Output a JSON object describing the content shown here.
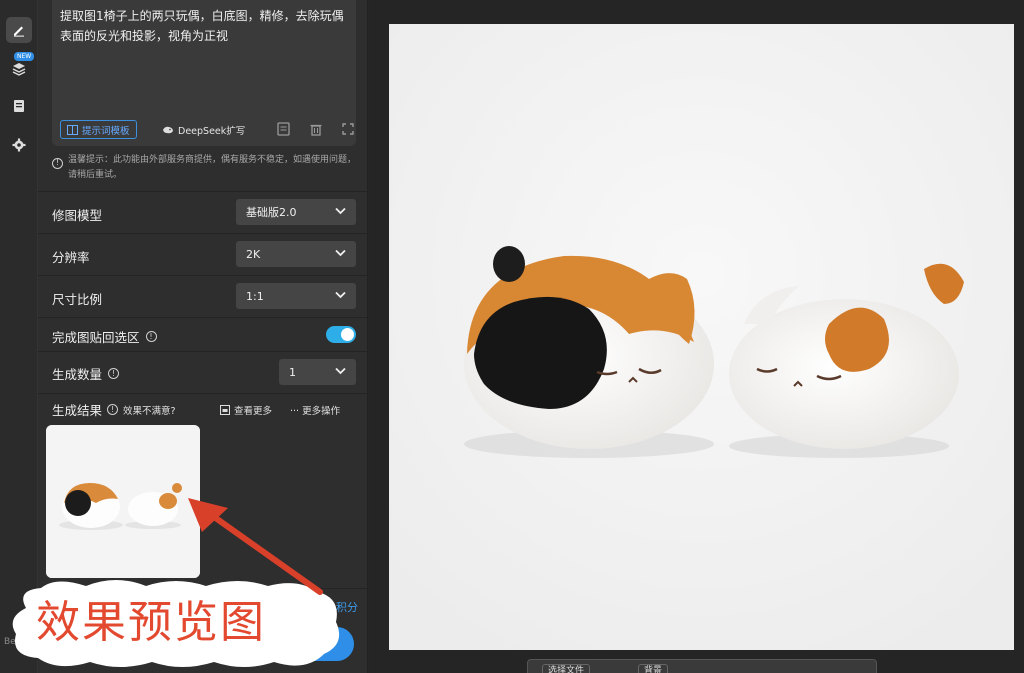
{
  "prompt": {
    "text": "提取图1椅子上的两只玩偶，白底图，精修，去除玩偶表面的反光和投影，视角为正视",
    "template_button": "提示词模板",
    "deepseek_button": "DeepSeek扩写"
  },
  "tip": "温馨提示：此功能由外部服务商提供，偶有服务不稳定，如遇使用问题，请稍后重试。",
  "rail": {
    "new_badge": "NEW",
    "version": "Be V0."
  },
  "settings": {
    "model": {
      "label": "修图模型",
      "value": "基础版2.0"
    },
    "resolution": {
      "label": "分辨率",
      "value": "2K"
    },
    "ratio": {
      "label": "尺寸比例",
      "value": "1:1"
    },
    "paste_back": {
      "label": "完成图贴回选区",
      "enabled": true
    },
    "count": {
      "label": "生成数量",
      "value": "1"
    }
  },
  "results": {
    "label": "生成结果",
    "unsatisfied": "效果不满意?",
    "view_more": "查看更多",
    "more_ops": "··· 更多操作"
  },
  "bottom": {
    "credit_text": "积分"
  },
  "annotation": {
    "text": "效果预览图"
  },
  "toolbar": {
    "select_file": "选择文件",
    "bg": "背景"
  },
  "colors": {
    "accent": "#2f8fe8",
    "toggle": "#2eaee8",
    "annotation": "#e2492f"
  }
}
